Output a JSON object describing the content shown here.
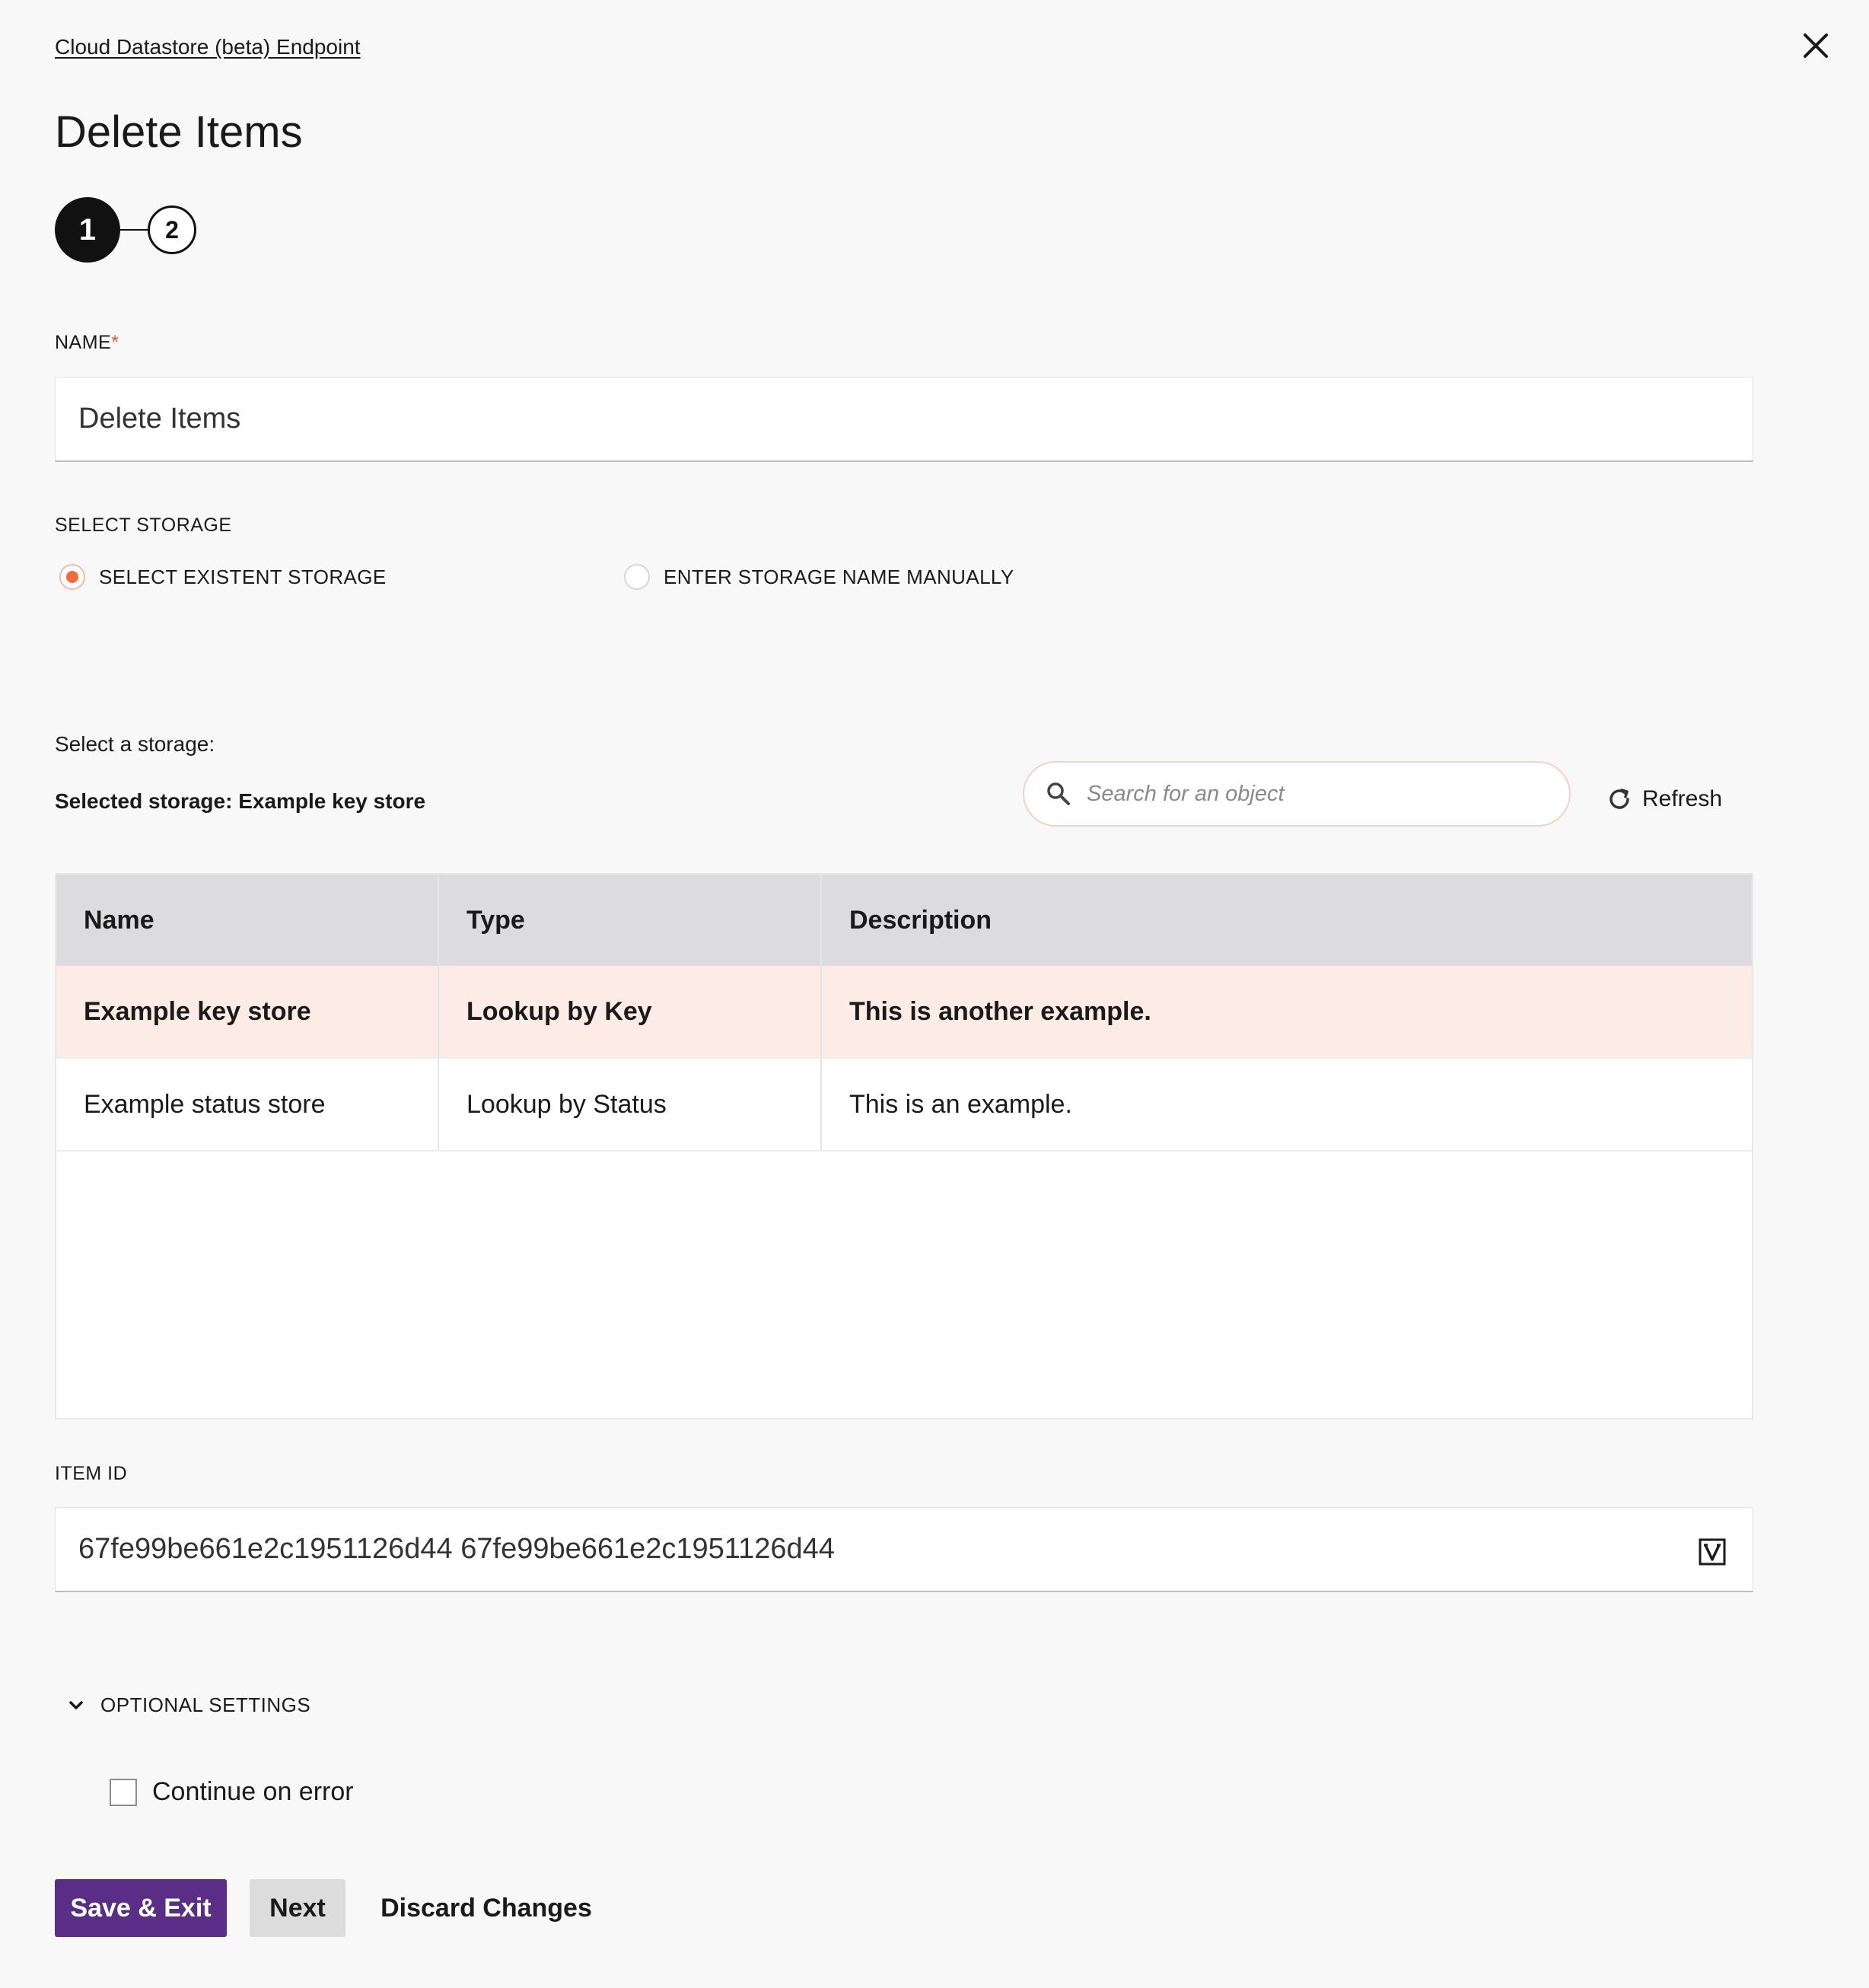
{
  "header": {
    "breadcrumb": "Cloud Datastore (beta) Endpoint",
    "title": "Delete Items",
    "close_icon": "close-icon"
  },
  "stepper": {
    "steps": [
      "1",
      "2"
    ],
    "active_step": 1
  },
  "form": {
    "name_label": "NAME",
    "name_required_mark": "*",
    "name_value": "Delete Items",
    "select_storage_label": "SELECT STORAGE",
    "radio_options": [
      {
        "label": "SELECT EXISTENT STORAGE",
        "checked": true
      },
      {
        "label": "ENTER STORAGE NAME MANUALLY",
        "checked": false
      }
    ],
    "select_a_storage_label": "Select a storage:",
    "selected_storage_text": "Selected storage: Example key store",
    "search_placeholder": "Search for an object",
    "refresh_label": "Refresh",
    "item_id_label": "ITEM ID",
    "item_id_value": "67fe99be661e2c1951126d44 67fe99be661e2c1951126d44",
    "variable_icon": "variable-icon"
  },
  "storage_table": {
    "columns": [
      "Name",
      "Type",
      "Description"
    ],
    "rows": [
      {
        "name": "Example key store",
        "type": "Lookup by Key",
        "description": "This is another example.",
        "selected": true
      },
      {
        "name": "Example status store",
        "type": "Lookup by Status",
        "description": "This is an example.",
        "selected": false
      }
    ]
  },
  "optional_settings": {
    "label": "OPTIONAL SETTINGS",
    "expanded": true,
    "continue_on_error_label": "Continue on error",
    "continue_on_error_checked": false
  },
  "footer": {
    "save_exit_label": "Save & Exit",
    "next_label": "Next",
    "discard_label": "Discard Changes"
  },
  "colors": {
    "accent_orange": "#f26b3a",
    "primary_purple": "#5a2e86",
    "selected_row_bg": "#fdece5",
    "table_header_bg": "#dcdcde"
  }
}
